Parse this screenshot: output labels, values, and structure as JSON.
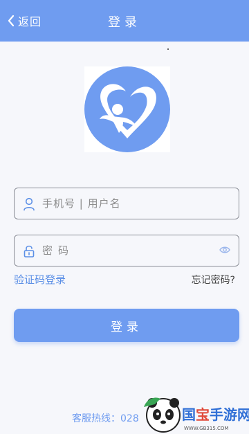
{
  "header": {
    "back_label": "返回",
    "title": "登录"
  },
  "form": {
    "username_placeholder": "手机号 | 用户名",
    "password_placeholder": "密码"
  },
  "links": {
    "sms_login": "验证码登录",
    "forgot_password": "忘记密码?"
  },
  "login_button": "登录",
  "footer": {
    "hotline": "客服热线：028"
  },
  "watermark": {
    "text": "国宝手游网",
    "url": "WWW.GB315.COM"
  },
  "icons": {
    "back": "chevron-left-icon",
    "logo": "heart-person-logo",
    "user": "user-icon",
    "lock": "lock-icon",
    "eye": "eye-icon"
  },
  "colors": {
    "primary": "#6f9cf0",
    "link": "#5b8fe6",
    "background": "#f6f7fb"
  }
}
